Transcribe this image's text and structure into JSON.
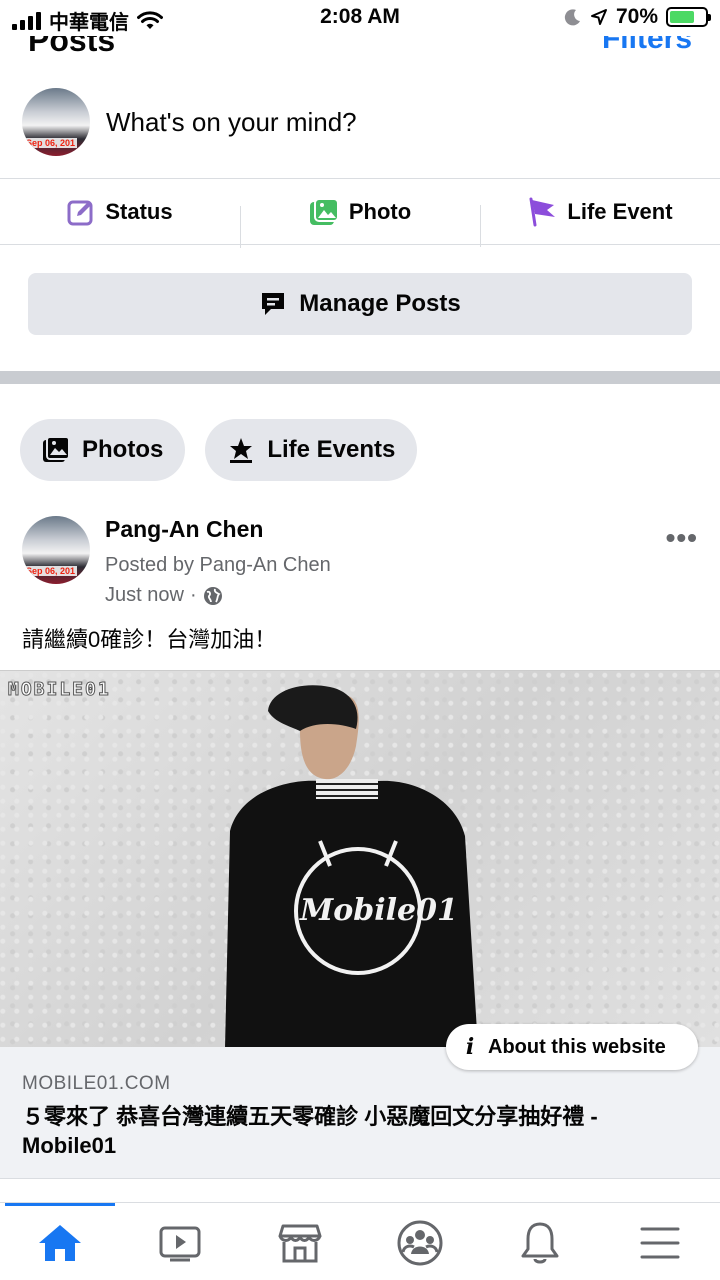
{
  "status_bar": {
    "carrier": "中華電信",
    "time": "2:08 AM",
    "battery": "70%",
    "battery_level": 0.7
  },
  "header": {
    "title": "Posts",
    "filters_label": "Filters"
  },
  "composer": {
    "placeholder": "What's on your mind?",
    "avatar_caption": "Sep 06, 201"
  },
  "actions": {
    "status": "Status",
    "photo": "Photo",
    "life_event": "Life Event"
  },
  "manage_posts": "Manage Posts",
  "chips": {
    "photos": "Photos",
    "life_events": "Life Events"
  },
  "post": {
    "author": "Pang-An Chen",
    "posted_by": "Posted by Pang-An Chen",
    "time": "Just now",
    "separator": "·",
    "text": "請繼續0確診！台灣加油！",
    "image_watermark": "MOBILE01",
    "about_label": "About this website",
    "link_domain": "MOBILE01.COM",
    "link_title": "５零來了 恭喜台灣連續五天零確診 小惡魔回文分享抽好禮 - Mobile01",
    "jacket_text": "Mobile01"
  },
  "tabs": [
    "home-icon",
    "watch-icon",
    "marketplace-icon",
    "groups-icon",
    "notifications-icon",
    "menu-icon"
  ],
  "colors": {
    "accent": "#1877f2",
    "chip_bg": "#e4e6eb",
    "secondary_text": "#65676b"
  }
}
